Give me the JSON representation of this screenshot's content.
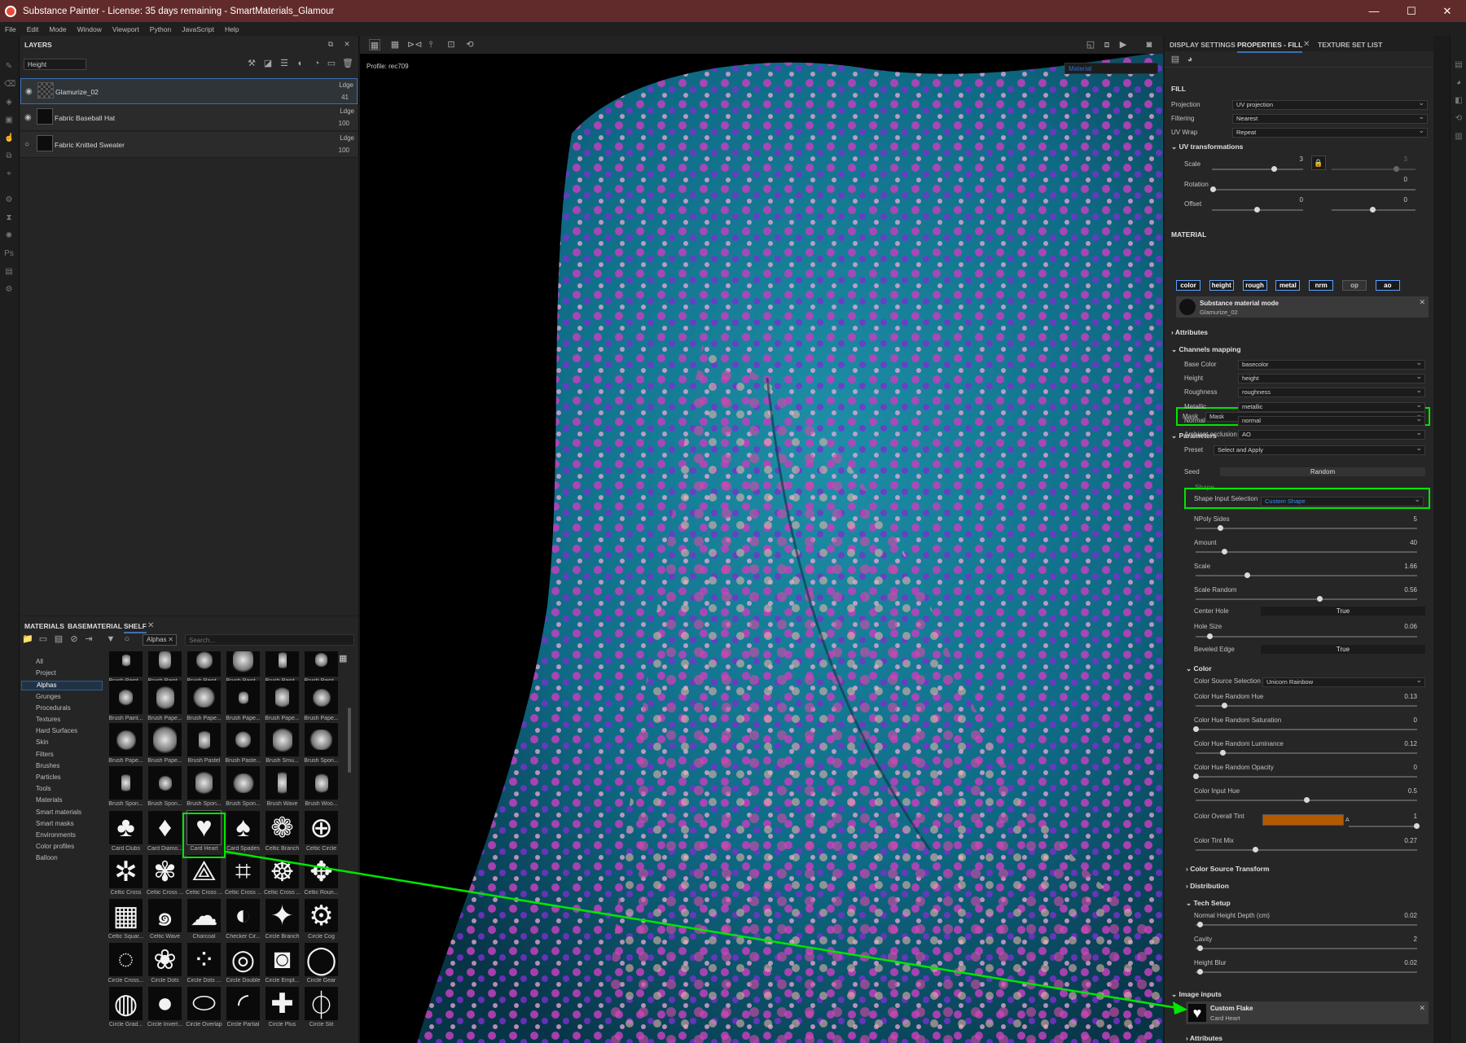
{
  "titlebar": {
    "title": "Substance Painter - License: 35 days remaining - SmartMaterials_Glamour",
    "minimize": "—",
    "maximize": "☐",
    "close": "✕"
  },
  "menu": [
    "File",
    "Edit",
    "Mode",
    "Window",
    "Viewport",
    "Python",
    "JavaScript",
    "Help"
  ],
  "layers": {
    "title": "LAYERS",
    "channel_select": "Height",
    "items": [
      {
        "name": "Glamurize_02",
        "blend": "Ldge",
        "opacity": "41"
      },
      {
        "name": "Fabric Baseball Hat",
        "blend": "Ldge",
        "opacity": "100"
      },
      {
        "name": "Fabric Knitted Sweater",
        "blend": "Ldge",
        "opacity": "100"
      }
    ]
  },
  "shelf": {
    "tabs": [
      "MATERIALS",
      "BASEMATERIAL",
      "SHELF"
    ],
    "filter_tag": "Alphas",
    "search_placeholder": "Search...",
    "categories": [
      "All",
      "Project",
      "Alphas",
      "Grunges",
      "Procedurals",
      "Textures",
      "Hard Surfaces",
      "Skin",
      "Filters",
      "Brushes",
      "Particles",
      "Tools",
      "Materials",
      "Smart materials",
      "Smart masks",
      "Environments",
      "Color profiles",
      "Balloon"
    ],
    "active_category": "Alphas",
    "tiles": [
      [
        "Brush Paint...",
        "Brush Paint...",
        "Brush Paint...",
        "Brush Paint...",
        "Brush Paint...",
        "Brush Paint..."
      ],
      [
        "Brush Paint...",
        "Brush Pape...",
        "Brush Pape...",
        "Brush Pape...",
        "Brush Pape...",
        "Brush Pape..."
      ],
      [
        "Brush Pape...",
        "Brush Pape...",
        "Brush Pastel",
        "Brush Paste...",
        "Brush Smu...",
        "Brush Spon..."
      ],
      [
        "Brush Spon...",
        "Brush Spon...",
        "Brush Spon...",
        "Brush Spon...",
        "Brush Wave",
        "Brush Woo..."
      ],
      [
        "Card Clubs",
        "Card Diamo...",
        "Card Heart",
        "Card Spades",
        "Celtic Branch",
        "Celtic Circle"
      ],
      [
        "Celtic Cross",
        "Celtic Cross ...",
        "Celtic Cross ...",
        "Celtic Cross ...",
        "Celtic Cross ...",
        "Celtic Roun..."
      ],
      [
        "Celtic Squar...",
        "Celtic Wave",
        "Charcoal",
        "Checker Cir...",
        "Circle Branch",
        "Circle Cog"
      ],
      [
        "Circle Cross...",
        "Circle Dots",
        "Circle Dots ...",
        "Circle Double",
        "Circle Empt...",
        "Circle Gear"
      ],
      [
        "Circle Grad...",
        "Circle Invert...",
        "Circle Overlap",
        "Circle Partial",
        "Circle Plus",
        "Circle Slit"
      ]
    ],
    "glyphs": [
      "♣",
      "♦",
      "♥",
      "♠",
      "❁",
      "⊕",
      "✲",
      "✾",
      "⟁",
      "⌗",
      "☸",
      "✥",
      "▦",
      "๑",
      "☁",
      "◐",
      "✦",
      "⚙",
      "◌",
      "❀",
      "⁘",
      "◎",
      "◙",
      "◯",
      "◍",
      "●",
      "⬭",
      "◜",
      "✚",
      "⏀"
    ]
  },
  "viewport": {
    "profile": "Profile: rec709",
    "mode_select": "Material"
  },
  "properties": {
    "tabs": [
      "DISPLAY SETTINGS",
      "PROPERTIES - FILL",
      "TEXTURE SET LIST"
    ],
    "fill_title": "FILL",
    "projection": {
      "label": "Projection",
      "value": "UV projection"
    },
    "filtering": {
      "label": "Filtering",
      "value": "Nearest"
    },
    "uvwrap": {
      "label": "UV Wrap",
      "value": "Repeat"
    },
    "uvtrans_title": "UV transformations",
    "scale": {
      "label": "Scale",
      "value": "3",
      "value2": "3"
    },
    "rotation": {
      "label": "Rotation",
      "value": "0"
    },
    "offset": {
      "label": "Offset",
      "value": "0",
      "value2": "0"
    },
    "material_title": "MATERIAL",
    "channels": [
      "color",
      "height",
      "rough",
      "metal",
      "nrm",
      "op",
      "ao"
    ],
    "substance_mode": "Substance material mode",
    "substance_name": "Glamurize_02",
    "attributes": "Attributes",
    "channels_mapping": "Channels mapping",
    "mapping": [
      {
        "label": "Base Color",
        "value": "basecolor"
      },
      {
        "label": "Height",
        "value": "height"
      },
      {
        "label": "Roughness",
        "value": "roughness"
      },
      {
        "label": "Metallic",
        "value": "metallic"
      },
      {
        "label": "Normal",
        "value": "normal"
      },
      {
        "label": "Ambient occlusion",
        "value": "AO"
      }
    ],
    "mask": {
      "label": "Mask",
      "value": "Mask"
    },
    "parameters": "Parameters",
    "preset": {
      "label": "Preset",
      "value": "Select and Apply"
    },
    "seed": {
      "label": "Seed",
      "value": "Random"
    },
    "shape_title": "Shape",
    "shape_input": {
      "label": "Shape Input Selection",
      "value": "Custom Shape"
    },
    "shape_sliders": [
      {
        "label": "NPoly Sides",
        "value": "5",
        "pos": 0.11
      },
      {
        "label": "Amount",
        "value": "40",
        "pos": 0.13
      },
      {
        "label": "Scale",
        "value": "1.66",
        "pos": 0.23
      },
      {
        "label": "Scale Random",
        "value": "0.56",
        "pos": 0.56
      }
    ],
    "center_hole": {
      "label": "Center Hole",
      "value": "True"
    },
    "hole_size": {
      "label": "Hole Size",
      "value": "0.06",
      "pos": 0.06
    },
    "beveled_edge": {
      "label": "Beveled Edge",
      "value": "True"
    },
    "color_title": "Color",
    "color_source": {
      "label": "Color Source Selection",
      "value": "Unicorn Rainbow"
    },
    "color_sliders": [
      {
        "label": "Color Hue Random Hue",
        "value": "0.13",
        "pos": 0.13
      },
      {
        "label": "Color Hue Random Saturation",
        "value": "0",
        "pos": 0.0
      },
      {
        "label": "Color Hue Random Luminance",
        "value": "0.12",
        "pos": 0.12
      },
      {
        "label": "Color Hue Random Opacity",
        "value": "0",
        "pos": 0.0
      },
      {
        "label": "Color Input Hue",
        "value": "0.5",
        "pos": 0.5
      }
    ],
    "overall_tint": {
      "label": "Color Overall Tint",
      "value": "1",
      "alpha_label": "A",
      "color": "#b35a00"
    },
    "tint_mix": {
      "label": "Color Tint Mix",
      "value": "0.27",
      "pos": 0.27
    },
    "color_source_transform": "Color Source Transform",
    "distribution": "Distribution",
    "tech_setup": "Tech Setup",
    "tech_sliders": [
      {
        "label": "Normal Height Depth (cm)",
        "value": "0.02",
        "pos": 0.02
      },
      {
        "label": "Cavity",
        "value": "2",
        "pos": 0.02
      },
      {
        "label": "Height Blur",
        "value": "0.02",
        "pos": 0.02
      }
    ],
    "image_inputs": "Image inputs",
    "custom_flake": "Custom Flake",
    "custom_flake_value": "Card Heart",
    "attributes2": "Attributes"
  },
  "colors": {
    "highlight": "#00e600",
    "selection": "#3d6fb0",
    "titlebar": "#622b2b"
  }
}
